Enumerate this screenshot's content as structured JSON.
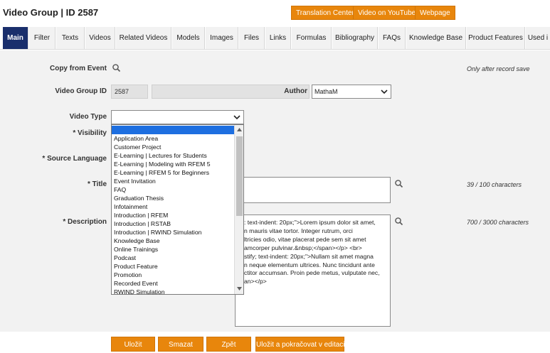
{
  "header": {
    "title": "Video Group | ID 2587",
    "buttons": [
      "Translation Center",
      "Video on YouTube",
      "Webpage"
    ]
  },
  "tabs": [
    {
      "label": "Main",
      "active": true
    },
    {
      "label": "Filter"
    },
    {
      "label": "Texts"
    },
    {
      "label": "Videos"
    },
    {
      "label": "Related Videos"
    },
    {
      "label": "Models"
    },
    {
      "label": "Images"
    },
    {
      "label": "Files"
    },
    {
      "label": "Links"
    },
    {
      "label": "Formulas"
    },
    {
      "label": "Bibliography"
    },
    {
      "label": "FAQs"
    },
    {
      "label": "Knowledge Base"
    },
    {
      "label": "Product Features"
    },
    {
      "label": "Used i"
    }
  ],
  "form": {
    "copy_from_event_label": "Copy from Event",
    "copy_from_event_note": "Only after record save",
    "video_group_id_label": "Video Group ID",
    "video_group_id_value": "2587",
    "author_label": "Author",
    "author_value": "MathaM",
    "video_type_label": "Video Type",
    "video_type_value": "",
    "visibility_label": "* Visibility",
    "source_language_label": "* Source Language",
    "title_label": "* Title",
    "title_counter": "39 / 100 characters",
    "description_label": "* Description",
    "description_counter": "700 / 3000 characters",
    "description_lines": [
      ": text-indent: 20px;\">Lorem ipsum dolor sit amet,",
      "n mauris vitae tortor. Integer rutrum, orci",
      "ltricies odio, vitae placerat pede sem sit amet",
      "amcorper pulvinar.&nbsp;</span></p> <br>",
      "stify; text-indent: 20px;\">Nullam sit amet magna",
      "n neque elementum ultrices. Nunc tincidunt ante",
      "ctitor accumsan. Proin pede metus, vulputate nec,",
      "an></p>"
    ]
  },
  "video_type_options": [
    "",
    "Application Area",
    "Customer Project",
    "E-Learning | Lectures for Students",
    "E-Learning | Modeling with RFEM 5",
    "E-Learning | RFEM 5 for Beginners",
    "Event Invitation",
    "FAQ",
    "Graduation Thesis",
    "Infotainment",
    "Introduction | RFEM",
    "Introduction | RSTAB",
    "Introduction | RWIND Simulation",
    "Knowledge Base",
    "Online Trainings",
    "Podcast",
    "Product Feature",
    "Promotion",
    "Recorded Event",
    "RWIND Simulation"
  ],
  "actions": [
    "Uložit",
    "Smazat",
    "Zpět",
    "Uložit a pokračovat v editaci"
  ],
  "colors": {
    "accent_orange": "#e8860c",
    "tab_active": "#1a2f6c",
    "dropdown_highlight": "#1e6fe0"
  },
  "icons": [
    "search-icon",
    "chevron-down-icon"
  ]
}
